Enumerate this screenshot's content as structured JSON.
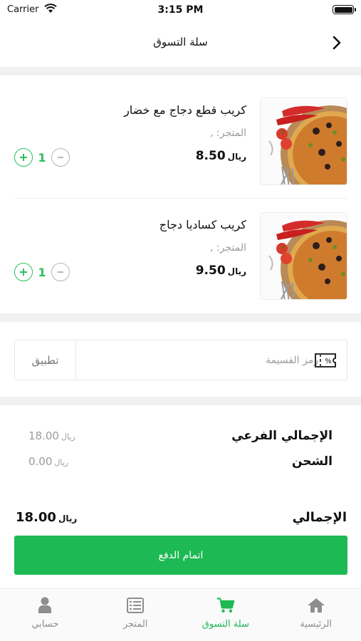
{
  "status_bar": {
    "carrier": "Carrier",
    "time": "3:15 PM"
  },
  "header": {
    "title": "سلة التسوق",
    "back_icon": "chevron-right-icon"
  },
  "items": [
    {
      "name": "كريب قطع دجاج مع خضار",
      "store": "المتجر: ,",
      "price": "8.50",
      "currency": "ريال",
      "quantity": "1"
    },
    {
      "name": "كريب كساديا دجاج",
      "store": "المتجر: ,",
      "price": "9.50",
      "currency": "ريال",
      "quantity": "1"
    }
  ],
  "coupon": {
    "placeholder": "رمز القسيمة",
    "apply_label": "تطبيق",
    "icon": "coupon-icon"
  },
  "summary": {
    "subtotal_label": "الإجمالي الفرعي",
    "subtotal_value": "18.00",
    "shipping_label": "الشحن",
    "shipping_value": "0.00",
    "total_label": "الإجمالي",
    "total_value": "18.00",
    "currency": "ريال"
  },
  "checkout": {
    "label": "اتمام الدفع"
  },
  "tabs": [
    {
      "label": "الرئيسية",
      "icon": "home-icon",
      "active": false
    },
    {
      "label": "سلة التسوق",
      "icon": "cart-icon",
      "active": true
    },
    {
      "label": "المتجر",
      "icon": "list-icon",
      "active": false
    },
    {
      "label": "حسابي",
      "icon": "user-icon",
      "active": false
    }
  ],
  "colors": {
    "accent": "#1db954",
    "muted": "#9b9b9b",
    "separator": "#f1f1f1"
  }
}
